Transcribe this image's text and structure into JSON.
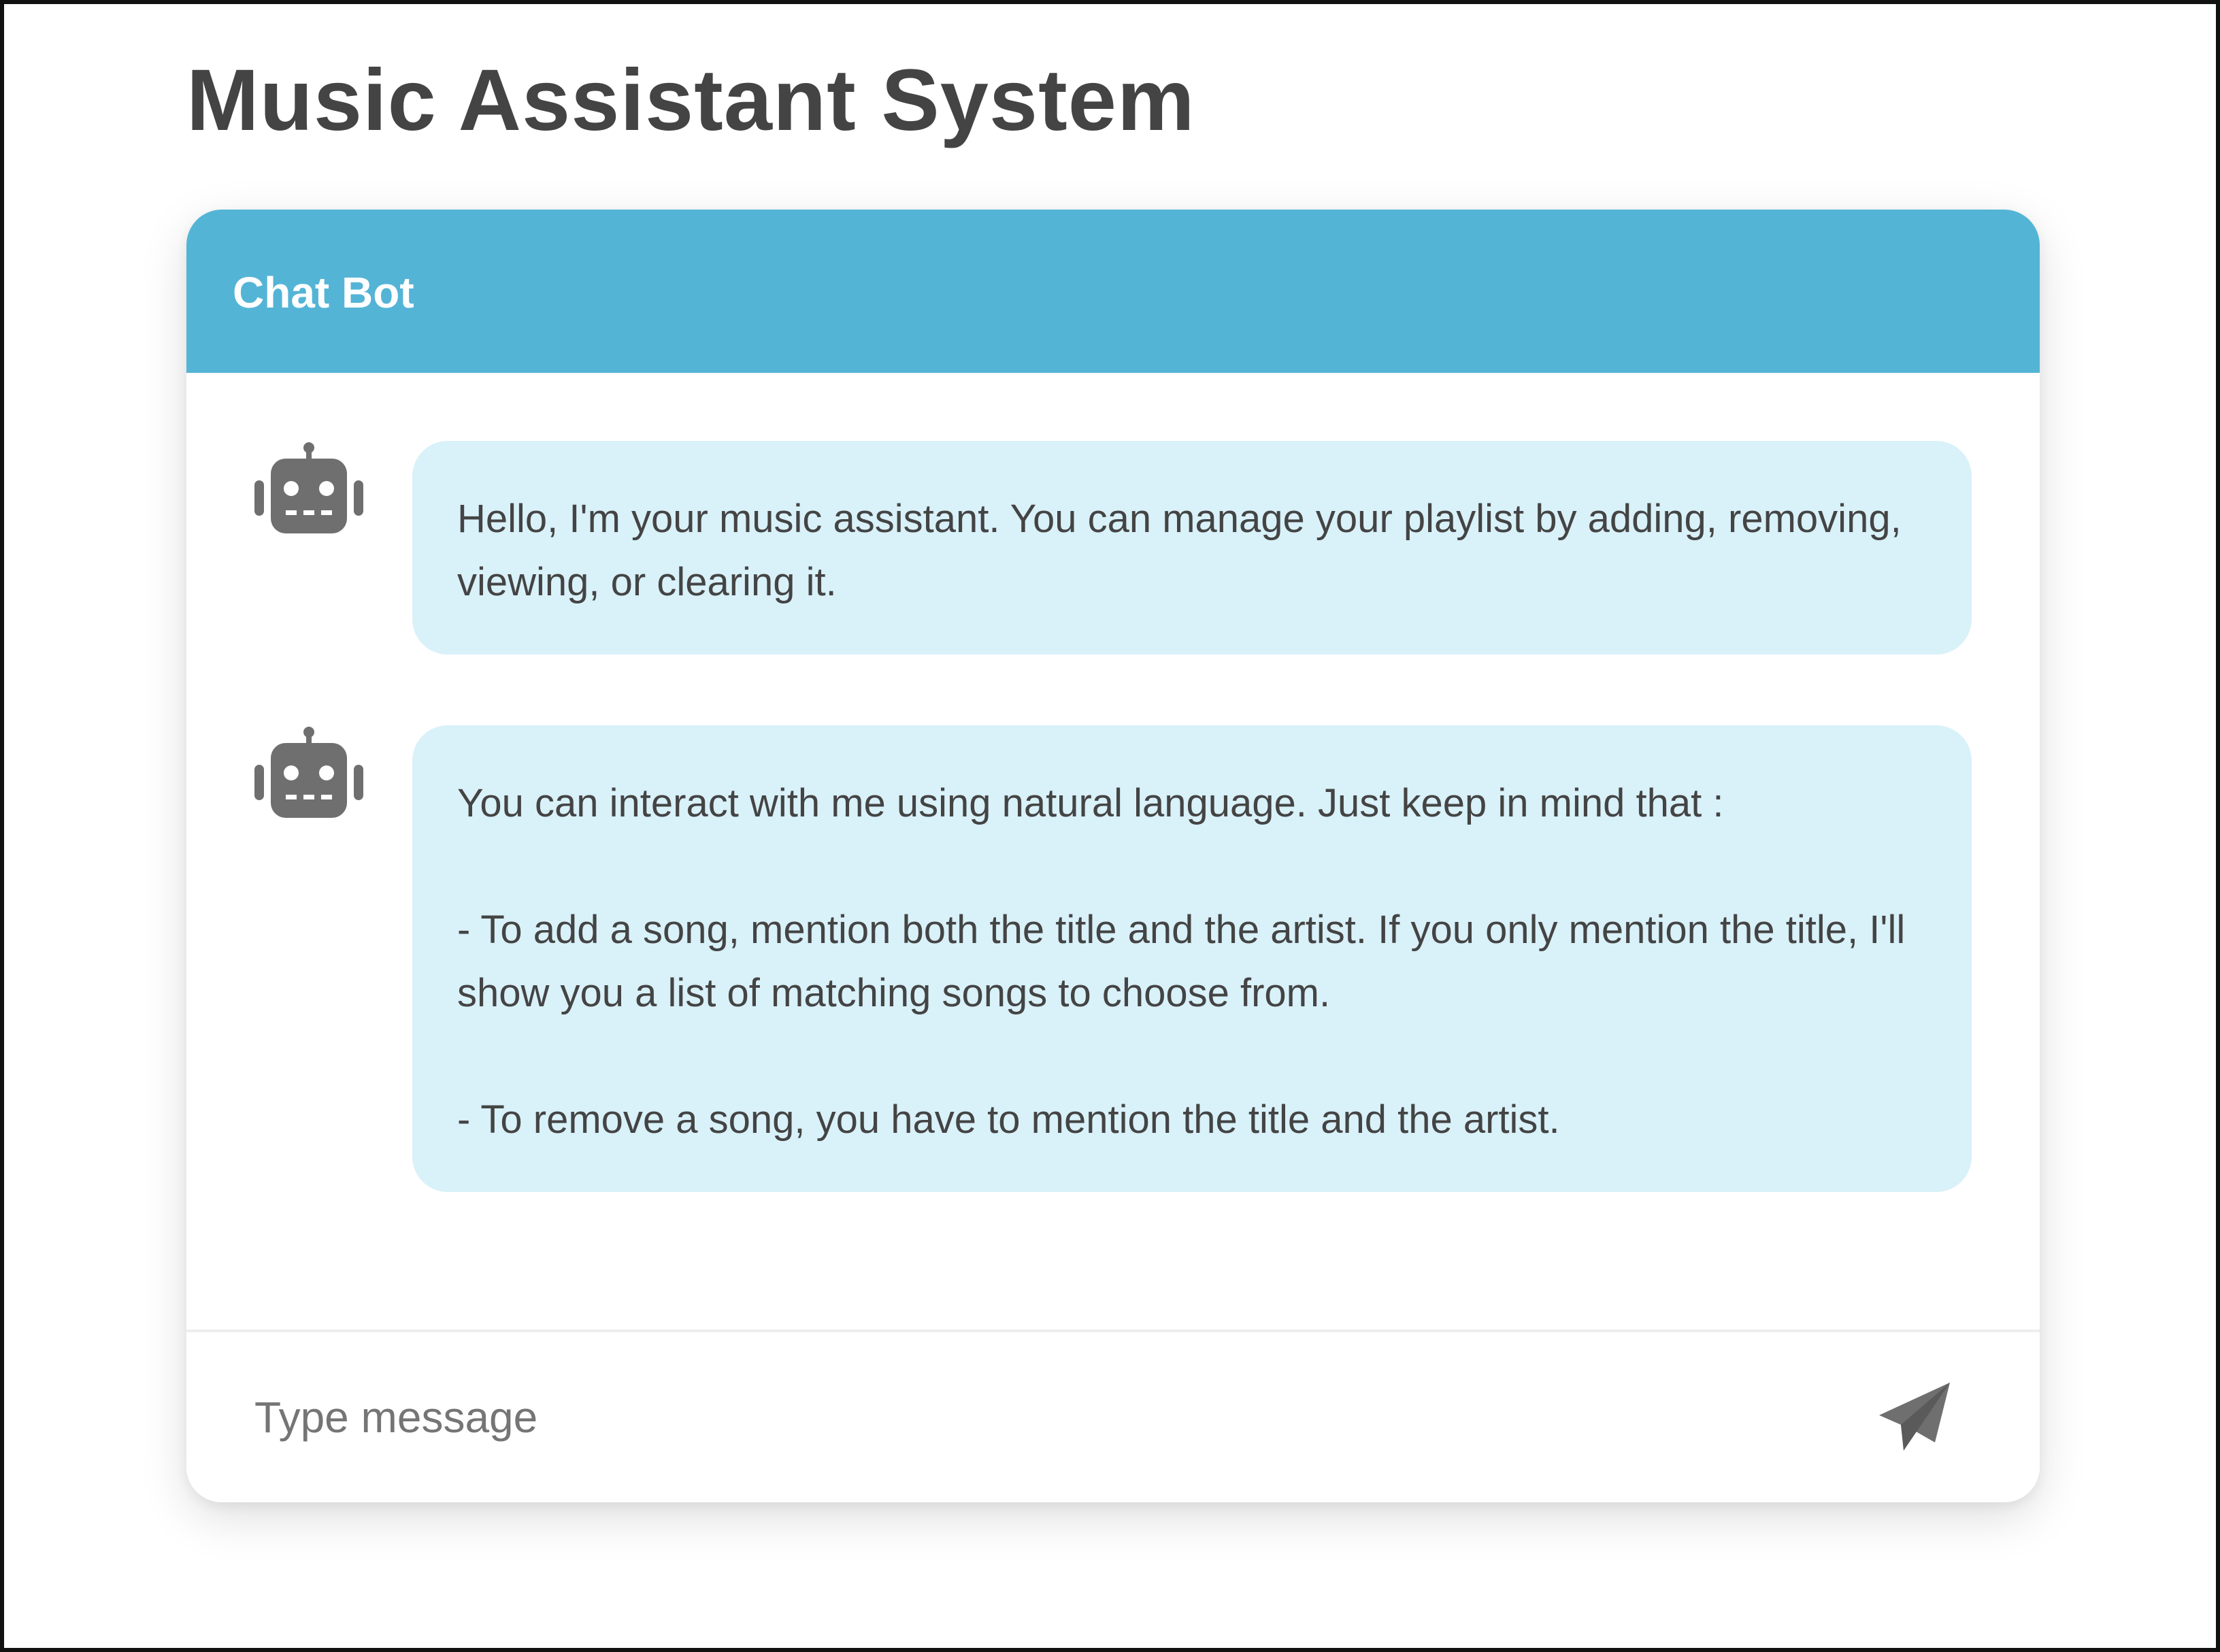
{
  "page": {
    "title": "Music Assistant System"
  },
  "chat": {
    "header_title": "Chat Bot",
    "messages": [
      {
        "sender": "bot",
        "avatar_icon": "robot-icon",
        "paragraphs": [
          "Hello, I'm your music assistant. You can manage your playlist by adding, removing, viewing, or clearing it."
        ]
      },
      {
        "sender": "bot",
        "avatar_icon": "robot-icon",
        "paragraphs": [
          "You can interact with me using natural language. Just keep in mind that :",
          "- To add a song, mention both the title and the artist. If you only mention the title, I'll show you a list of matching songs to choose from.",
          "- To remove a song, you have to mention the title and the artist."
        ]
      }
    ],
    "composer": {
      "placeholder": "Type message",
      "value": "",
      "send_icon": "paper-plane-icon"
    }
  },
  "colors": {
    "header_background": "#54b4d6",
    "bubble_background": "#d9f1f9",
    "icon_gray": "#6f6f6f",
    "text": "#444444"
  }
}
